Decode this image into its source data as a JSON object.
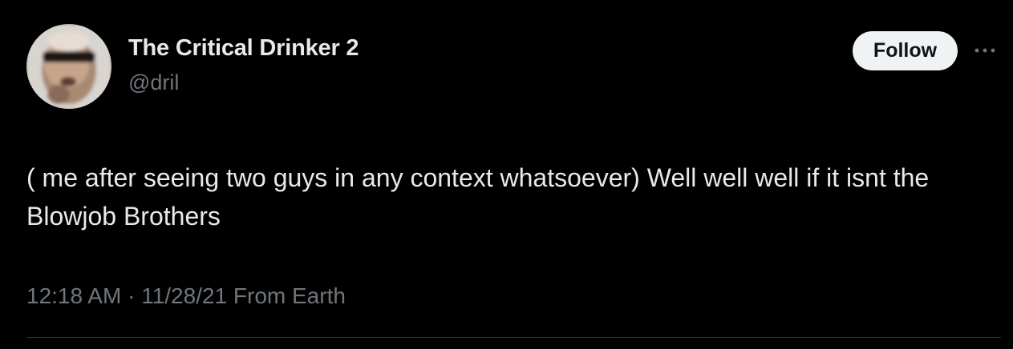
{
  "author": {
    "display_name": "The Critical Drinker 2",
    "handle": "@dril"
  },
  "actions": {
    "follow_label": "Follow",
    "more_icon": "more-horizontal-icon"
  },
  "tweet": {
    "text": "( me after seeing two guys in any context whatsoever) Well well well if it isnt the Blowjob Brothers",
    "time": "12:18 AM",
    "separator": " · ",
    "date": "11/28/21",
    "source": " From Earth"
  },
  "colors": {
    "background": "#000000",
    "primary_text": "#e7e9ea",
    "secondary_text": "#71767b",
    "follow_bg": "#eff3f4",
    "follow_text": "#0f1419",
    "divider": "#2f3336"
  }
}
